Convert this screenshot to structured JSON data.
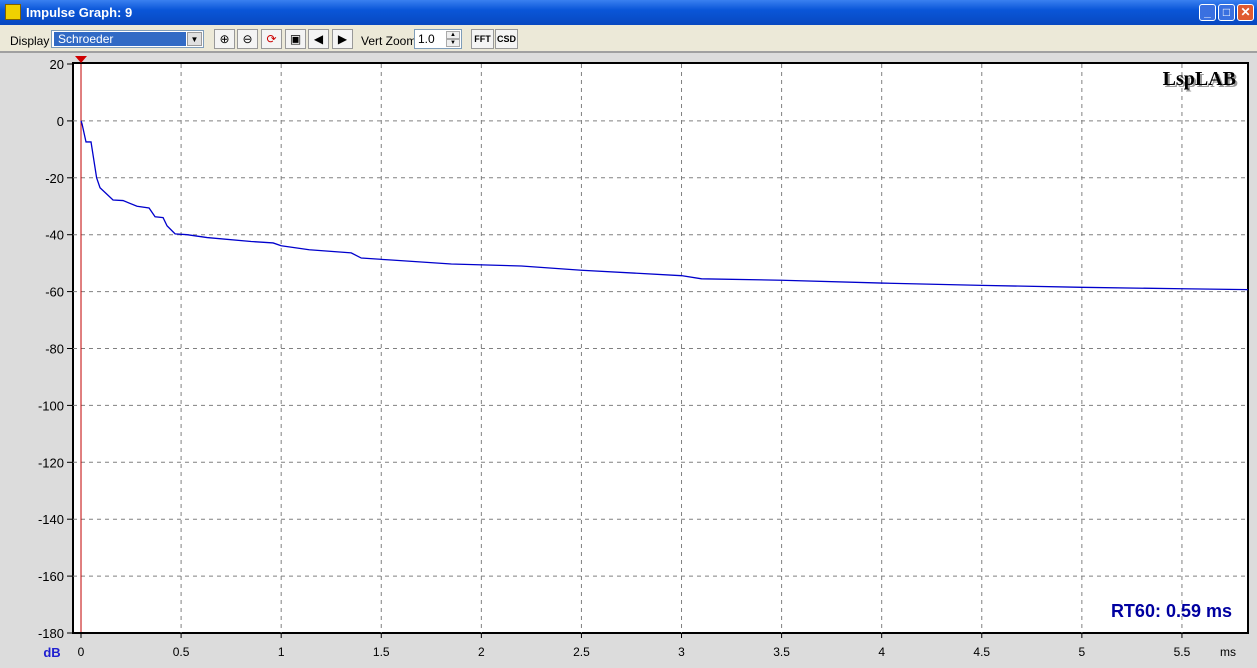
{
  "window": {
    "title": "Impulse Graph: 9",
    "minimize": "_",
    "maximize": "□",
    "close": "✕"
  },
  "toolbar": {
    "display_label": "Display",
    "display_value": "Schroeder",
    "zoom_in": "zoom-in",
    "zoom_out": "zoom-out",
    "zoom_reset": "zoom-reset",
    "zoom_fit": "zoom-fit",
    "prev": "◀",
    "next": "▶",
    "vert_zoom_label": "Vert Zoom",
    "vert_zoom_value": "1.0",
    "fft": "FFT",
    "csd": "CSD"
  },
  "graph": {
    "logo": "LspLAB",
    "rt60": "RT60: 0.59 ms"
  },
  "chart_data": {
    "type": "line",
    "title": "",
    "xlabel": "ms",
    "ylabel": "dB",
    "xlim": [
      -0.04,
      5.83
    ],
    "ylim": [
      -180,
      20
    ],
    "xticks": [
      0,
      0.5,
      1,
      1.5,
      2,
      2.5,
      3,
      3.5,
      4,
      4.5,
      5,
      5.5
    ],
    "xtick_labels": [
      "0",
      "0.5",
      "1",
      "1.5",
      "2",
      "2.5",
      "3",
      "3.5",
      "4",
      "4.5",
      "5",
      "5.5"
    ],
    "yticks": [
      20,
      0,
      -20,
      -40,
      -60,
      -80,
      -100,
      -120,
      -140,
      -160,
      -180
    ],
    "ytick_labels": [
      "20",
      "0",
      "-20",
      "-40",
      "-60",
      "-80",
      "-100",
      "-120",
      "-140",
      "-160",
      "-180"
    ],
    "grid": true,
    "series": [
      {
        "name": "Schroeder",
        "color": "#0000cc",
        "x": [
          0,
          0.005,
          0.025,
          0.05,
          0.078,
          0.095,
          0.16,
          0.21,
          0.28,
          0.34,
          0.37,
          0.41,
          0.43,
          0.47,
          0.53,
          0.63,
          0.85,
          0.96,
          1.0,
          1.14,
          1.35,
          1.4,
          1.55,
          1.85,
          2.2,
          2.5,
          3.0,
          3.1,
          3.5,
          4.0,
          4.5,
          5.0,
          5.5,
          5.83
        ],
        "y": [
          0,
          -1,
          -7.4,
          -7.4,
          -20,
          -23.5,
          -27.8,
          -28,
          -30,
          -30.6,
          -33.7,
          -34,
          -36.9,
          -39.7,
          -40,
          -41,
          -42.4,
          -42.9,
          -43.9,
          -45.3,
          -46.4,
          -48.2,
          -48.9,
          -50.3,
          -51,
          -52.5,
          -54.4,
          -55.5,
          -56,
          -57,
          -57.8,
          -58.5,
          -59,
          -59.3
        ]
      }
    ],
    "marker_x": 0
  }
}
